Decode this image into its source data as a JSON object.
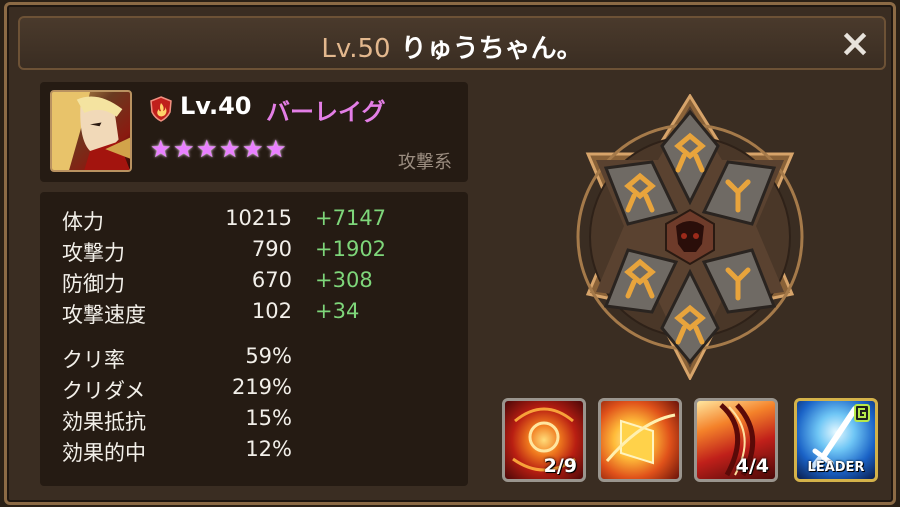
{
  "header": {
    "level": "Lv.50",
    "title": "りゅうちゃん。",
    "close_icon": "×"
  },
  "monster": {
    "level": "Lv.40",
    "name": "バーレイグ",
    "type": "攻撃系",
    "stars": 6,
    "star_glyph": "★",
    "attribute": "fire"
  },
  "stats": [
    {
      "label": "体力",
      "value": "10215",
      "bonus": "+7147"
    },
    {
      "label": "攻撃力",
      "value": "790",
      "bonus": "+1902"
    },
    {
      "label": "防御力",
      "value": "670",
      "bonus": "+308"
    },
    {
      "label": "攻撃速度",
      "value": "102",
      "bonus": "+34"
    },
    {
      "label": "クリ率",
      "value": "59%",
      "bonus": ""
    },
    {
      "label": "クリダメ",
      "value": "219%",
      "bonus": ""
    },
    {
      "label": "効果抵抗",
      "value": "15%",
      "bonus": ""
    },
    {
      "label": "効果的中",
      "value": "12%",
      "bonus": ""
    }
  ],
  "skills": [
    {
      "icon": "fire-orb-skill-icon",
      "count": "2/9"
    },
    {
      "icon": "fire-shield-skill-icon",
      "count": ""
    },
    {
      "icon": "fire-slash-skill-icon",
      "count": "4/4"
    },
    {
      "icon": "leader-sword-skill-icon",
      "count": "",
      "leader_label": "LEADER"
    }
  ],
  "colors": {
    "accent_level": "#e3b88e",
    "name_color": "#e37ee6",
    "bonus_color": "#7ed67a",
    "rune_glyph": "#e8a43c"
  }
}
